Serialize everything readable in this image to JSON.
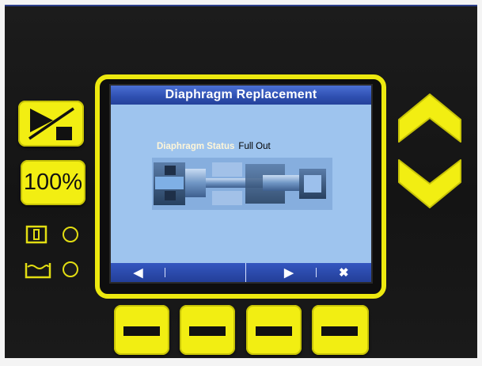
{
  "screen": {
    "title": "Diaphragm Replacement",
    "status_label": "Diaphragm Status",
    "status_value": "Full Out",
    "softkeys": [
      {
        "label": "◀",
        "icon": "left-arrow-icon"
      },
      {
        "label": "",
        "icon": "blank"
      },
      {
        "label": "",
        "icon": "blank"
      },
      {
        "label": "▶",
        "icon": "right-arrow-icon"
      },
      {
        "label": "✖",
        "icon": "close-icon"
      }
    ]
  },
  "controls": {
    "speed_button_label": "100%",
    "start_stop_icon": "play-stop-icon",
    "up_icon": "chevron-up-icon",
    "down_icon": "chevron-down-icon",
    "run_indicator_icon": "run-status-icon",
    "tank_indicator_icon": "tank-level-icon"
  },
  "colors": {
    "accent_yellow": "#f2ee12",
    "panel_black": "#161616",
    "screen_blue": "#9ec4ee",
    "bar_blue": "#2e4fb0"
  }
}
